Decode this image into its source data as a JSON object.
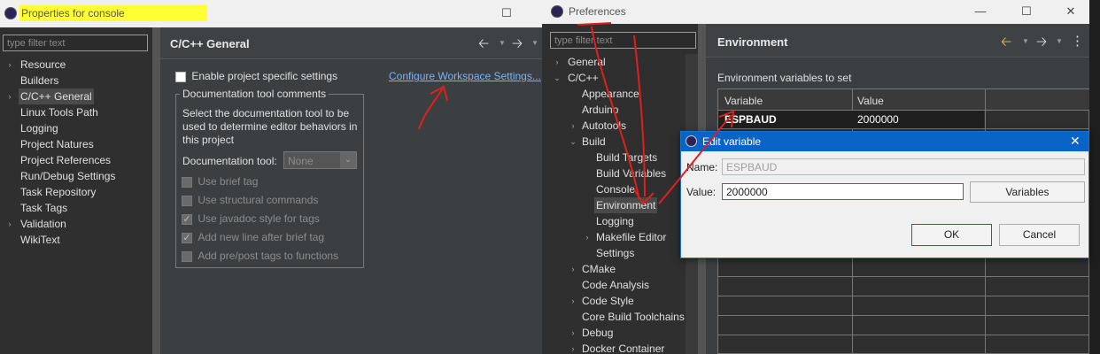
{
  "left_window": {
    "title": "Properties for console",
    "filter_placeholder": "type filter text",
    "tree": [
      "Resource",
      "Builders",
      "C/C++ General",
      "Linux Tools Path",
      "Logging",
      "Project Natures",
      "Project References",
      "Run/Debug Settings",
      "Task Repository",
      "Task Tags",
      "Validation",
      "WikiText"
    ],
    "page_title": "C/C++ General",
    "enable_label": "Enable project specific settings",
    "configure_link": "Configure Workspace Settings...",
    "group_title": "Documentation tool comments",
    "group_desc": "Select the documentation tool to be used to determine editor behaviors in this project",
    "doc_tool_label": "Documentation tool:",
    "doc_tool_value": "None",
    "options": [
      "Use brief tag",
      "Use structural commands",
      "Use javadoc style for tags",
      "Add new line after brief tag",
      "Add pre/post tags to functions"
    ]
  },
  "right_window": {
    "title": "Preferences",
    "filter_placeholder": "type filter text",
    "tree": {
      "general": "General",
      "cpp": "C/C++",
      "appearance": "Appearance",
      "arduino": "Arduino",
      "autotools": "Autotools",
      "build": "Build",
      "build_targets": "Build Targets",
      "build_variables": "Build Variables",
      "console": "Console",
      "environment": "Environment",
      "logging": "Logging",
      "makefile_editor": "Makefile Editor",
      "settings": "Settings",
      "cmake": "CMake",
      "code_analysis": "Code Analysis",
      "code_style": "Code Style",
      "core_build": "Core Build Toolchains",
      "debug": "Debug",
      "docker": "Docker Container"
    },
    "page_title": "Environment",
    "env_label": "Environment variables to set",
    "col_variable": "Variable",
    "col_value": "Value",
    "row_variable": "ESPBAUD",
    "row_value": "2000000"
  },
  "dialog": {
    "title": "Edit variable",
    "name_label": "Name:",
    "name_value": "ESPBAUD",
    "value_label": "Value:",
    "value_value": "2000000",
    "variables_button": "Variables",
    "ok_button": "OK",
    "cancel_button": "Cancel"
  }
}
